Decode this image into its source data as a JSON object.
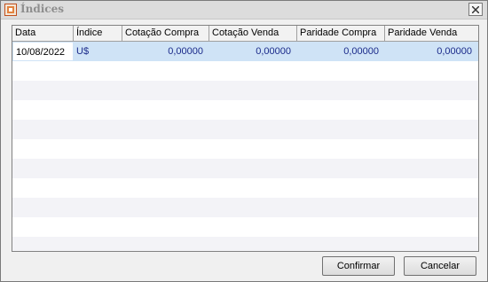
{
  "window": {
    "title": "Índices",
    "app_icon": "orange-app-icon",
    "close_icon": "close-icon"
  },
  "grid": {
    "columns": [
      "Data",
      "Índice",
      "Cotação Compra",
      "Cotação Venda",
      "Paridade Compra",
      "Paridade Venda"
    ],
    "rows": [
      [
        "10/08/2022",
        "U$",
        "0,00000",
        "0,00000",
        "0,00000",
        "0,00000"
      ]
    ],
    "selected_row": 0
  },
  "buttons": {
    "confirm": "Confirmar",
    "cancel": "Cancelar"
  },
  "colors": {
    "selection": "#cfe3f6",
    "cell_text": "#1a2a8a"
  }
}
